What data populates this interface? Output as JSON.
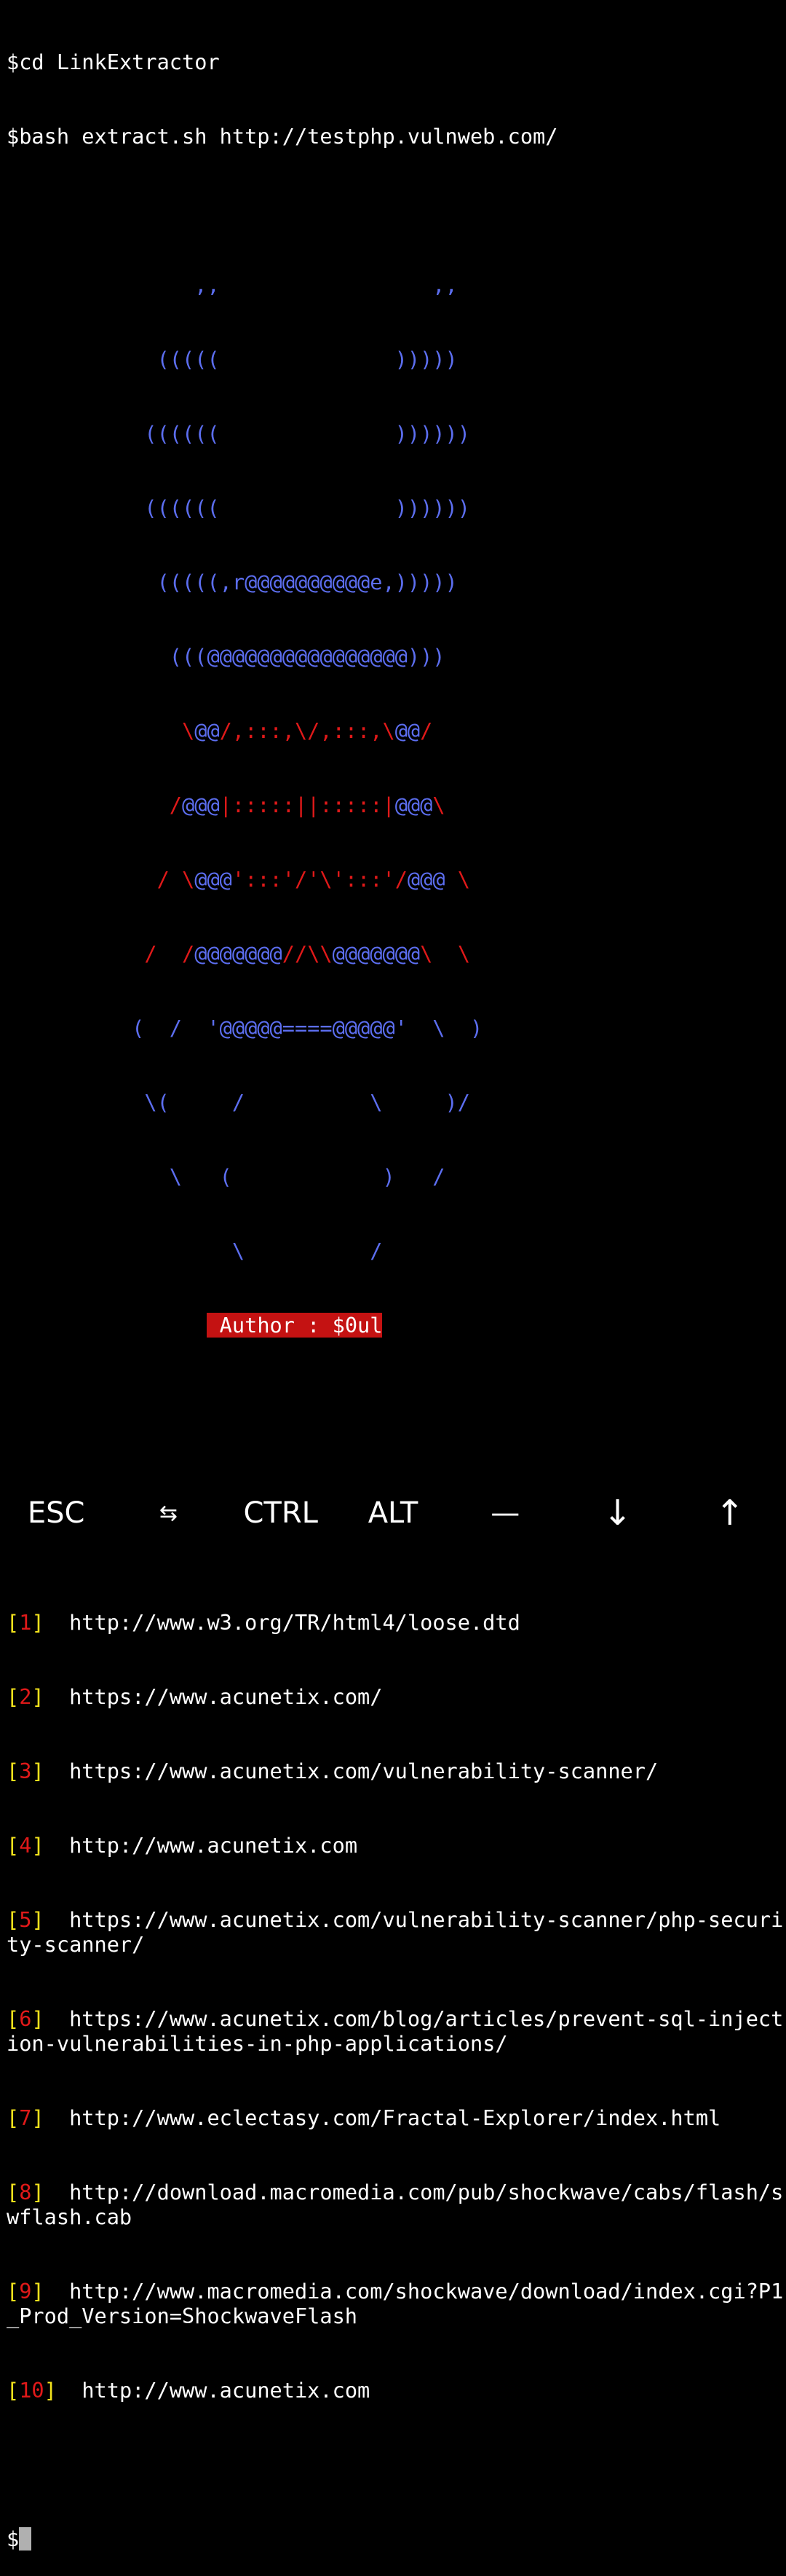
{
  "terminal": {
    "commands": [
      {
        "prompt": "$",
        "text": "cd LinkExtractor"
      },
      {
        "prompt": "$",
        "text": "bash extract.sh http://testphp.vulnweb.com/"
      }
    ],
    "ascii_art": [
      "               ,,                 ,,",
      "            (((((              )))))",
      "           ((((((              ))))))",
      "           ((((((              ))))))",
      "            (((((,r@@@@@@@@@@e,)))))",
      "             (((@@@@@@@@@@@@@@@@)))",
      "              \\@@/,:::,\\/,:::,\\@@/",
      "             /@@@|:::::||:::::|@@@\\",
      "            / \\@@@':::'/'\\':::'/@@@ \\",
      "           /  /@@@@@@@//\\\\@@@@@@@\\  \\",
      "          (  /  '@@@@@====@@@@@'  \\  )",
      "           \\(     /          \\     )/",
      "             \\   (            )   /",
      "                  \\          /"
    ],
    "author": " Author : $0ul",
    "links": [
      {
        "num": "1",
        "url": "http://www.w3.org/TR/html4/loose.dtd"
      },
      {
        "num": "2",
        "url": "https://www.acunetix.com/"
      },
      {
        "num": "3",
        "url": "https://www.acunetix.com/vulnerability-scanner/"
      },
      {
        "num": "4",
        "url": "http://www.acunetix.com"
      },
      {
        "num": "5",
        "url": "https://www.acunetix.com/vulnerability-scanner/php-security-scanner/"
      },
      {
        "num": "6",
        "url": "https://www.acunetix.com/blog/articles/prevent-sql-injection-vulnerabilities-in-php-applications/"
      },
      {
        "num": "7",
        "url": "http://www.eclectasy.com/Fractal-Explorer/index.html"
      },
      {
        "num": "8",
        "url": "http://download.macromedia.com/pub/shockwave/cabs/flash/swflash.cab"
      },
      {
        "num": "9",
        "url": "http://www.macromedia.com/shockwave/download/index.cgi?P1_Prod_Version=ShockwaveFlash"
      },
      {
        "num": "10",
        "url": "http://www.acunetix.com"
      }
    ],
    "final_prompt": "$"
  },
  "extra_keys": [
    {
      "label": "ESC",
      "icon": "esc-key"
    },
    {
      "label": "⇆",
      "icon": "tab-icon"
    },
    {
      "label": "CTRL",
      "icon": "ctrl-key"
    },
    {
      "label": "ALT",
      "icon": "alt-key"
    },
    {
      "label": "—",
      "icon": "dash-icon"
    },
    {
      "label": "↓",
      "icon": "arrow-down-icon"
    },
    {
      "label": "↑",
      "icon": "arrow-up-icon"
    }
  ],
  "colors": {
    "background": "#000000",
    "art_blue": "#5c6ef0",
    "art_red": "#e01919",
    "bracket_yellow": "#f2e21c",
    "author_bg": "#c41212"
  }
}
